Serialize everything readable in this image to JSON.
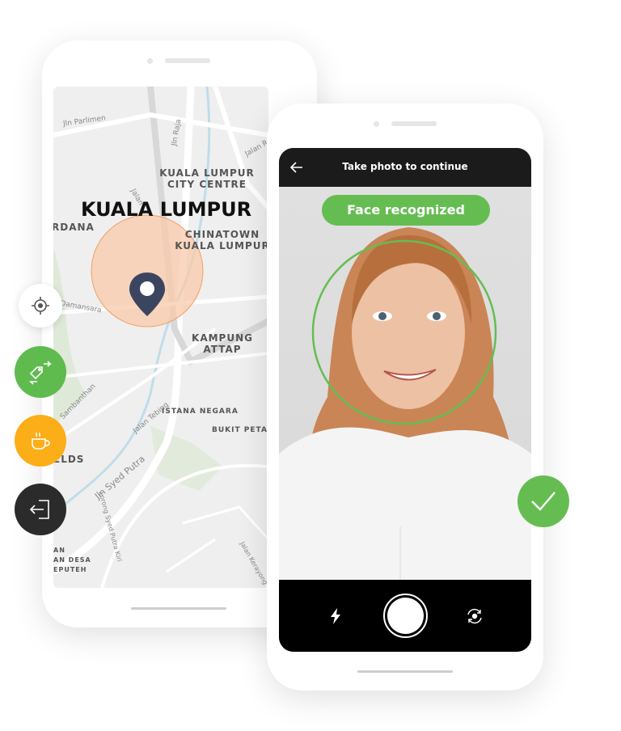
{
  "map": {
    "city": "KUALA LUMPUR",
    "districts": [
      "KUALA LUMPUR\nCITY CENTRE",
      "CHINATOWN\nKUALA LUMPUR",
      "KAMPUNG\nATTAP",
      "ISTANA NEGARA",
      "BUKIT PETALING",
      "RDANA",
      "ELDS",
      "AN\nAN DESA\nEPUTEH"
    ],
    "roads": [
      "Jln Parlimen",
      "Jln Raja",
      "Jalan R",
      "Jalan",
      "Damansara",
      "Sambanthan",
      "Jalan Tebing",
      "Jln Syed Putra",
      "Lorong Syed Putra Kiri",
      "Jalan Kerayong"
    ],
    "accent_circle": "#f8c9a8",
    "pin_color": "#3c4560"
  },
  "side_buttons": [
    {
      "icon": "locate-icon",
      "color": "#ffffff"
    },
    {
      "icon": "tag-swap-icon",
      "color": "#5fbb4e"
    },
    {
      "icon": "coffee-cup-icon",
      "color": "#fbae17"
    },
    {
      "icon": "logout-icon",
      "color": "#2b2b2b"
    }
  ],
  "camera": {
    "title": "Take photo to continue",
    "back_icon": "arrow-left-icon",
    "status": "Face recognized",
    "status_color": "#65bd52",
    "flash_icon": "flash-icon",
    "switch_icon": "switch-camera-icon"
  },
  "confirm": {
    "icon": "checkmark-icon",
    "color": "#65bd52"
  }
}
